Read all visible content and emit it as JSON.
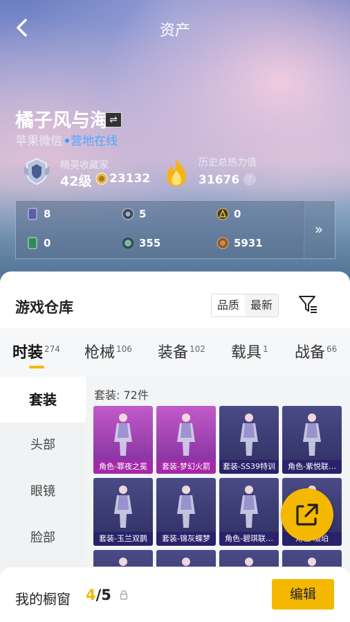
{
  "header": {
    "title": "资产"
  },
  "profile": {
    "name": "橘子风与海",
    "platform": "苹果微信",
    "status": "营地在线",
    "rank_title": "精英收藏家",
    "level": "42级",
    "coins": "23132",
    "heat_title": "历史总热力值",
    "heat_value": "31676",
    "help_symbol": "?"
  },
  "stats": [
    {
      "icon": "card-icon",
      "value": "8"
    },
    {
      "icon": "token-icon",
      "value": "5"
    },
    {
      "icon": "medal-icon",
      "value": "0"
    },
    {
      "icon": "ticket-icon",
      "value": "0"
    },
    {
      "icon": "orb-icon",
      "value": "355"
    },
    {
      "icon": "bronze-coin-icon",
      "value": "5931"
    }
  ],
  "stats_more": "»",
  "warehouse": {
    "title": "游戏仓库",
    "sort_options": [
      "品质",
      "最新"
    ],
    "tabs": [
      {
        "label": "时装",
        "count": "274"
      },
      {
        "label": "枪械",
        "count": "106"
      },
      {
        "label": "装备",
        "count": "102"
      },
      {
        "label": "载具",
        "count": "1"
      },
      {
        "label": "战备",
        "count": "66"
      }
    ],
    "categories": [
      "套装",
      "头部",
      "眼镜",
      "脸部"
    ],
    "count_label": "套装: 72件",
    "items": [
      {
        "label": "角色-罪夜之冕",
        "rarity": "pink"
      },
      {
        "label": "套装-梦幻火箭",
        "rarity": "pink"
      },
      {
        "label": "套装-SS39特训",
        "rarity": "purple"
      },
      {
        "label": "角色-紫悦联…",
        "rarity": "purple"
      },
      {
        "label": "套装-玉兰双鹊",
        "rarity": "purple"
      },
      {
        "label": "套装-锦灰蝶梦",
        "rarity": "purple"
      },
      {
        "label": "角色-碧琪联…",
        "rarity": "purple"
      },
      {
        "label": "角色-凝珀",
        "rarity": "purple"
      },
      {
        "label": "",
        "rarity": "purple"
      },
      {
        "label": "",
        "rarity": "purple"
      },
      {
        "label": "",
        "rarity": "purple"
      },
      {
        "label": "",
        "rarity": "purple"
      }
    ]
  },
  "showcase": {
    "label": "我的橱窗",
    "current": "4",
    "separator": "/",
    "total": "5",
    "edit_label": "编辑"
  },
  "colors": {
    "accent": "#f5b800",
    "online": "#4da8ff",
    "item_pink": "#c35ac8",
    "item_purple": "#4a4a86"
  }
}
